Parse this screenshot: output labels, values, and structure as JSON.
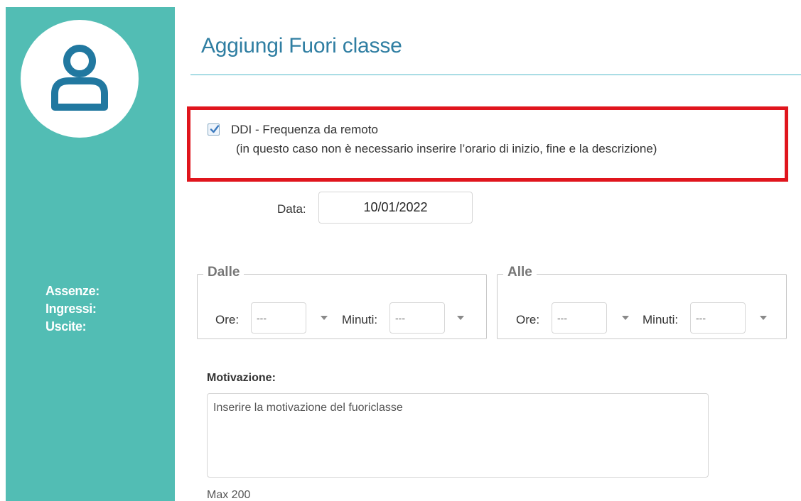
{
  "page": {
    "title": "Aggiungi Fuori classe"
  },
  "sidebar": {
    "avatar_icon": "user-icon",
    "stats": [
      {
        "label": "Assenze:"
      },
      {
        "label": "Ingressi:"
      },
      {
        "label": "Uscite:"
      }
    ]
  },
  "ddi": {
    "checked": true,
    "label": "DDI - Frequenza da remoto",
    "note": "(in questo caso non è necessario inserire l’orario di inizio, fine e la descrizione)"
  },
  "date": {
    "label": "Data:",
    "value": "10/01/2022"
  },
  "dalle": {
    "legend": "Dalle",
    "ore_label": "Ore:",
    "ore_value": "---",
    "minuti_label": "Minuti:",
    "minuti_value": "---"
  },
  "alle": {
    "legend": "Alle",
    "ore_label": "Ore:",
    "ore_value": "---",
    "minuti_label": "Minuti:",
    "minuti_value": "---"
  },
  "motivazione": {
    "label": "Motivazione:",
    "placeholder": "Inserire la motivazione del fuoriclasse",
    "max_text": "Max 200"
  },
  "colors": {
    "sidebar": "#52bdb4",
    "title": "#2f7ea2",
    "highlight": "#e0151d",
    "avatar_icon": "#2178a0"
  }
}
